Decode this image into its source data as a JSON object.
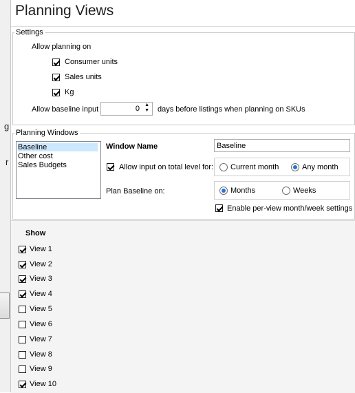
{
  "title": "Planning Views",
  "left_panel": {
    "glyphs": [
      "g",
      "r"
    ]
  },
  "settings": {
    "legend": "Settings",
    "allow_planning_label": "Allow planning on",
    "units": [
      {
        "label": "Consumer units",
        "checked": true
      },
      {
        "label": "Sales units",
        "checked": true
      },
      {
        "label": "Kg",
        "checked": true
      }
    ],
    "baseline_label": "Allow baseline input",
    "baseline_value": "0",
    "baseline_suffix": "days before listings when planning on SKUs"
  },
  "planning_windows": {
    "legend": "Planning Windows",
    "items": [
      "Baseline",
      "Other cost",
      "Sales Budgets"
    ],
    "selected": "Baseline",
    "window_name_label": "Window Name",
    "window_name_value": "Baseline",
    "allow_input_label": "Allow input on total level for:",
    "allow_input_checked": true,
    "month_options": [
      {
        "label": "Current month",
        "checked": false
      },
      {
        "label": "Any month",
        "checked": true
      }
    ],
    "plan_baseline_label": "Plan Baseline on:",
    "plan_options": [
      {
        "label": "Months",
        "checked": true
      },
      {
        "label": "Weeks",
        "checked": false
      }
    ],
    "per_view_label": "Enable per-view month/week settings",
    "per_view_checked": true
  },
  "show": {
    "header": "Show",
    "views": [
      {
        "label": "View 1",
        "checked": true
      },
      {
        "label": "View 2",
        "checked": true
      },
      {
        "label": "View 3",
        "checked": true
      },
      {
        "label": "View 4",
        "checked": true
      },
      {
        "label": "View 5",
        "checked": false
      },
      {
        "label": "View 6",
        "checked": false
      },
      {
        "label": "View 7",
        "checked": false
      },
      {
        "label": "View 8",
        "checked": false
      },
      {
        "label": "View 9",
        "checked": false
      },
      {
        "label": "View 10",
        "checked": true
      }
    ]
  },
  "colors": {
    "accent": "#2a72d9",
    "border": "#c9c9c9",
    "selection": "#cce8ff"
  }
}
